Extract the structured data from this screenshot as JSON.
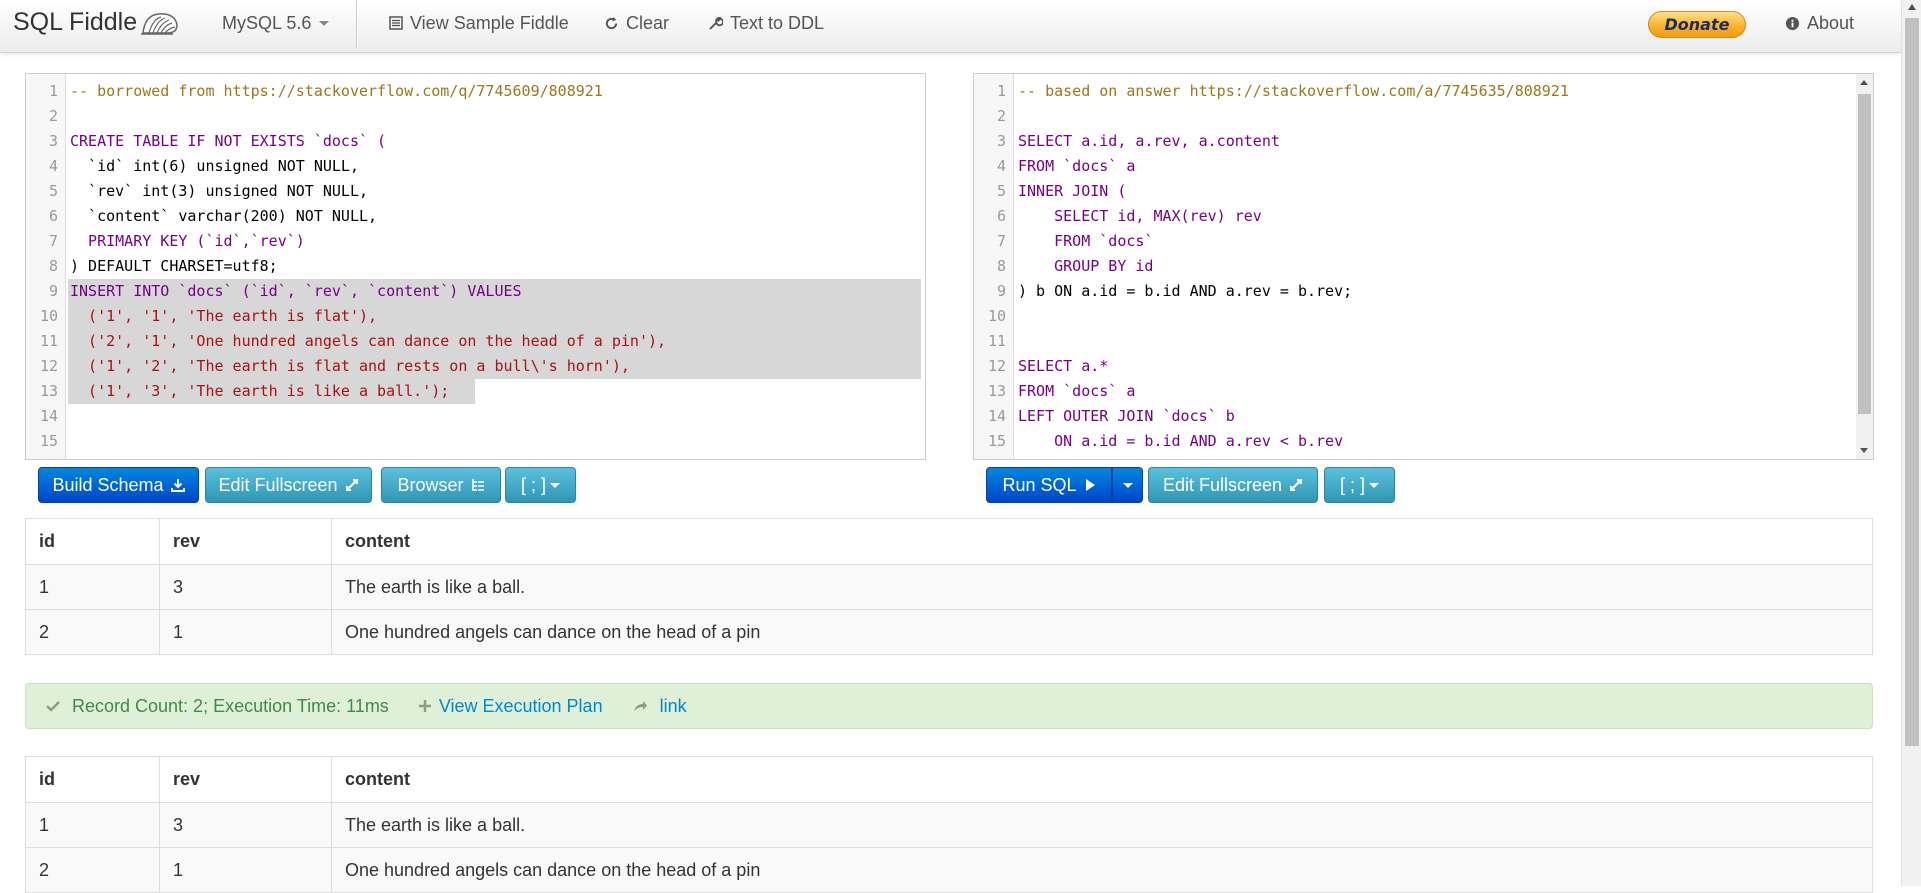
{
  "navbar": {
    "brand": "SQL Fiddle",
    "db_select": "MySQL 5.6",
    "view_sample": "View Sample Fiddle",
    "clear": "Clear",
    "text_to_ddl": "Text to DDL",
    "donate": "Donate",
    "about": "About"
  },
  "schema_editor": {
    "lines": [
      "-- borrowed from https://stackoverflow.com/q/7745609/808921",
      "",
      "CREATE TABLE IF NOT EXISTS `docs` (",
      "  `id` int(6) unsigned NOT NULL,",
      "  `rev` int(3) unsigned NOT NULL,",
      "  `content` varchar(200) NOT NULL,",
      "  PRIMARY KEY (`id`,`rev`)",
      ") DEFAULT CHARSET=utf8;",
      "INSERT INTO `docs` (`id`, `rev`, `content`) VALUES",
      "  ('1', '1', 'The earth is flat'),",
      "  ('2', '1', 'One hundred angels can dance on the head of a pin'),",
      "  ('1', '2', 'The earth is flat and rests on a bull\\'s horn'),",
      "  ('1', '3', 'The earth is like a ball.');",
      "",
      ""
    ]
  },
  "query_editor": {
    "lines": [
      "-- based on answer https://stackoverflow.com/a/7745635/808921",
      "",
      "SELECT a.id, a.rev, a.content",
      "FROM `docs` a",
      "INNER JOIN (",
      "    SELECT id, MAX(rev) rev",
      "    FROM `docs`",
      "    GROUP BY id",
      ") b ON a.id = b.id AND a.rev = b.rev;",
      "",
      "",
      "SELECT a.*",
      "FROM `docs` a",
      "LEFT OUTER JOIN `docs` b",
      "    ON a.id = b.id AND a.rev < b.rev"
    ]
  },
  "buttons": {
    "build_schema": "Build Schema",
    "edit_fullscreen": "Edit Fullscreen",
    "browser": "Browser",
    "terminator": "[ ; ]",
    "run_sql": "Run SQL",
    "edit_fullscreen_right": "Edit Fullscreen",
    "terminator_right": "[ ; ]"
  },
  "results": [
    {
      "columns": [
        "id",
        "rev",
        "content"
      ],
      "rows": [
        [
          "1",
          "3",
          "The earth is like a ball."
        ],
        [
          "2",
          "1",
          "One hundred angels can dance on the head of a pin"
        ]
      ]
    },
    {
      "columns": [
        "id",
        "rev",
        "content"
      ],
      "rows": [
        [
          "1",
          "3",
          "The earth is like a ball."
        ],
        [
          "2",
          "1",
          "One hundred angels can dance on the head of a pin"
        ]
      ]
    }
  ],
  "status": {
    "record_info": "Record Count: 2; Execution Time: 11ms",
    "view_plan": "View Execution Plan",
    "link": "link"
  },
  "colors": {
    "primary": "#0044cc",
    "info": "#2f96b4",
    "success_bg": "#dff0d8",
    "success_text": "#468847",
    "link": "#0088cc"
  }
}
